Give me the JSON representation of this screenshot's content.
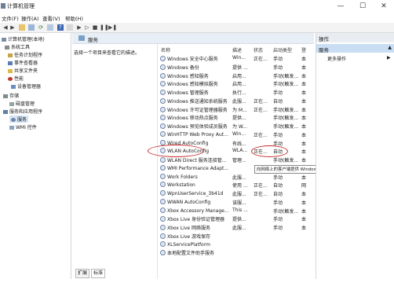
{
  "window": {
    "title": "计算机管理",
    "minimize": "—",
    "maximize": "☐",
    "close": "✕"
  },
  "menu": [
    "文件(F)",
    "操作(A)",
    "查看(V)",
    "帮助(H)"
  ],
  "toolbar_icons": [
    "back-icon",
    "forward-icon",
    "folder-icon",
    "properties-icon",
    "refresh-icon",
    "export-icon",
    "help-icon",
    "console-icon",
    "play-icon",
    "play-alt-icon",
    "stop-icon",
    "pause-icon",
    "restart-icon"
  ],
  "tree": {
    "root": "计算机管理(本地)",
    "system_tools": "系统工具",
    "task_scheduler": "任务计划程序",
    "event_viewer": "事件查看器",
    "shared_folders": "共享文件夹",
    "performance": "性能",
    "device_manager": "设备管理器",
    "storage": "存储",
    "disk_management": "磁盘管理",
    "services_apps": "服务和应用程序",
    "services": "服务",
    "wmi": "WMI 控件"
  },
  "main": {
    "title": "服务",
    "description": "选择一个项目来查看它的描述。",
    "columns": {
      "name": "名称",
      "desc": "描述",
      "status": "状态",
      "startup": "启动类型",
      "logon": "登"
    },
    "rows": [
      {
        "name": "Windows 安全中心服务",
        "desc": "Win...",
        "status": "正在...",
        "startup": "手动",
        "logon": "本"
      },
      {
        "name": "Windows 备份",
        "desc": "提供 ...",
        "status": "",
        "startup": "手动",
        "logon": "本"
      },
      {
        "name": "Windows 感知服务",
        "desc": "启用...",
        "status": "",
        "startup": "手动(触发...",
        "logon": "本"
      },
      {
        "name": "Windows 感知模拟服务",
        "desc": "启用...",
        "status": "",
        "startup": "手动(触发...",
        "logon": "本"
      },
      {
        "name": "Windows 管理服务",
        "desc": "执行...",
        "status": "",
        "startup": "手动",
        "logon": "本"
      },
      {
        "name": "Windows 推送通知系统服务",
        "desc": "此服...",
        "status": "正在...",
        "startup": "自动",
        "logon": "本"
      },
      {
        "name": "Windows 许可证管理器服务",
        "desc": "为 M...",
        "status": "正在...",
        "startup": "手动(触发...",
        "logon": "本"
      },
      {
        "name": "Windows 移动热点服务",
        "desc": "提供...",
        "status": "",
        "startup": "手动(触发...",
        "logon": "本"
      },
      {
        "name": "Windows 预览体验成员服务",
        "desc": "为 W...",
        "status": "",
        "startup": "手动(触发...",
        "logon": "本"
      },
      {
        "name": "WinHTTP Web Proxy Aut...",
        "desc": "Win...",
        "status": "正在...",
        "startup": "手动",
        "logon": "本"
      },
      {
        "name": "Wired AutoConfig",
        "desc": "有线...",
        "status": "",
        "startup": "手动",
        "logon": "本"
      },
      {
        "name": "WLAN AutoConfig",
        "desc": "WLA...",
        "status": "正在...",
        "startup": "自动",
        "logon": "本"
      },
      {
        "name": "WLAN Direct 服务连接管...",
        "desc": "管理...",
        "status": "",
        "startup": "手动(触发...",
        "logon": "本"
      },
      {
        "name": "WMI Performance Adapt...",
        "desc": "",
        "status": "",
        "startup": "",
        "logon": ""
      },
      {
        "name": "Work Folders",
        "desc": "此服...",
        "status": "",
        "startup": "手动",
        "logon": "本"
      },
      {
        "name": "Workstation",
        "desc": "使用 ...",
        "status": "正在...",
        "startup": "自动",
        "logon": "网"
      },
      {
        "name": "WpnUserService_3b41d",
        "desc": "此服...",
        "status": "正在...",
        "startup": "自动",
        "logon": "本"
      },
      {
        "name": "WWAN AutoConfig",
        "desc": "该服...",
        "status": "",
        "startup": "手动",
        "logon": "本"
      },
      {
        "name": "Xbox Accessory Manage...",
        "desc": "This ...",
        "status": "",
        "startup": "手动(触发...",
        "logon": "本"
      },
      {
        "name": "Xbox Live 身份验证管理器",
        "desc": "提供...",
        "status": "",
        "startup": "手动",
        "logon": "本"
      },
      {
        "name": "Xbox Live 网络服务",
        "desc": "此服...",
        "status": "",
        "startup": "手动",
        "logon": "本"
      },
      {
        "name": "Xbox Live 游戏保存",
        "desc": "",
        "status": "",
        "startup": "",
        "logon": ""
      },
      {
        "name": "XLServicePlatform",
        "desc": "",
        "status": "",
        "startup": "",
        "logon": ""
      },
      {
        "name": "本地配置文件助手服务",
        "desc": "",
        "status": "",
        "startup": "",
        "logon": ""
      }
    ],
    "tooltip": "向网络上的客户端提供 Windows Management Instrumentation (WMI)",
    "tabs": [
      "扩展",
      "标准"
    ]
  },
  "actions": {
    "header": "操作",
    "section": "服务",
    "more": "更多操作"
  },
  "colors": {
    "selection": "#c9ddf3",
    "header": "#e8eef6",
    "annotation": "#c82a2a"
  }
}
